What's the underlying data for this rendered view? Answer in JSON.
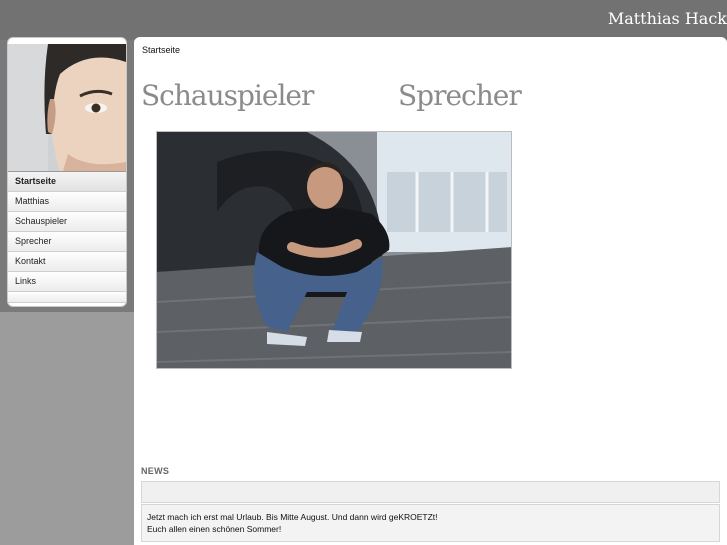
{
  "site": {
    "name": "Matthias Hack"
  },
  "sidebar": {
    "items": [
      {
        "label": "Startseite",
        "active": true
      },
      {
        "label": "Matthias"
      },
      {
        "label": "Schauspieler"
      },
      {
        "label": "Sprecher"
      },
      {
        "label": "Kontakt"
      },
      {
        "label": "Links"
      }
    ]
  },
  "main": {
    "breadcrumb": "Startseite",
    "links": {
      "schauspieler": "Schauspieler",
      "sprecher": "Sprecher"
    }
  },
  "news": {
    "title": "NEWS",
    "line1": "Jetzt mach ich erst mal Urlaub. Bis Mitte August. Und dann wird geKROETZt!",
    "line2": "Euch allen einen schönen Sommer!"
  },
  "colors": {
    "header_bg": "#727272",
    "page_bg": "#9a9a9a",
    "heading_gray": "#8b8b8b"
  }
}
